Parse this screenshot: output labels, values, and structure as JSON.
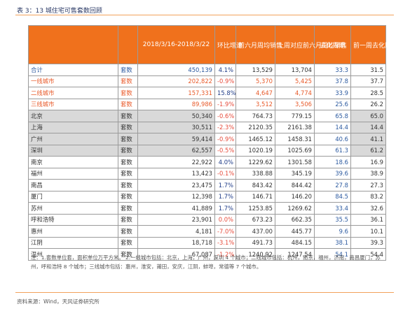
{
  "caption": "表 3：13 城住宅可售套数回顾",
  "header": {
    "col1": "",
    "col2": "",
    "col3": "2018/3/16-2018/3/22",
    "col4": "环比增速",
    "col5": "前六月周均销售",
    "col6": "上周对应前六月周均销售",
    "col7": "去化周期",
    "col8": "前一周去化周期"
  },
  "rows": [
    {
      "name": "合计",
      "unit": "套数",
      "value": "450,139",
      "chg": "4.1%",
      "avg6": "13,529",
      "prev6": "13,704",
      "cycle": "33.3",
      "prevcycle": "31.5",
      "style": "blue",
      "neg": false
    },
    {
      "name": "一线城市",
      "unit": "套数",
      "value": "202,822",
      "chg": "-0.9%",
      "avg6": "5,370",
      "prev6": "5,425",
      "cycle": "37.8",
      "prevcycle": "37.7",
      "style": "orange",
      "neg": true
    },
    {
      "name": "二线城市",
      "unit": "套数",
      "value": "157,331",
      "chg": "15.8%",
      "avg6": "4,647",
      "prev6": "4,774",
      "cycle": "33.9",
      "prevcycle": "28.5",
      "style": "orange",
      "neg": false
    },
    {
      "name": "三线城市",
      "unit": "套数",
      "value": "89,986",
      "chg": "-1.9%",
      "avg6": "3,512",
      "prev6": "3,506",
      "cycle": "25.6",
      "prevcycle": "26.2",
      "style": "orange",
      "neg": true
    },
    {
      "name": "北京",
      "unit": "套数",
      "value": "50,340",
      "chg": "-0.6%",
      "avg6": "764.73",
      "prev6": "779.15",
      "cycle": "65.8",
      "prevcycle": "65.0",
      "style": "gray",
      "neg": true
    },
    {
      "name": "上海",
      "unit": "套数",
      "value": "30,511",
      "chg": "-2.3%",
      "avg6": "2120.35",
      "prev6": "2161.38",
      "cycle": "14.4",
      "prevcycle": "14.4",
      "style": "gray",
      "neg": true
    },
    {
      "name": "广州",
      "unit": "套数",
      "value": "59,414",
      "chg": "-0.9%",
      "avg6": "1465.12",
      "prev6": "1458.31",
      "cycle": "40.6",
      "prevcycle": "41.1",
      "style": "gray",
      "neg": true
    },
    {
      "name": "深圳",
      "unit": "套数",
      "value": "62,557",
      "chg": "-0.5%",
      "avg6": "1020.19",
      "prev6": "1025.69",
      "cycle": "61.3",
      "prevcycle": "61.2",
      "style": "gray",
      "neg": true
    },
    {
      "name": "南京",
      "unit": "套数",
      "value": "22,922",
      "chg": "4.0%",
      "avg6": "1229.62",
      "prev6": "1301.58",
      "cycle": "18.6",
      "prevcycle": "16.9",
      "style": "plain",
      "neg": false
    },
    {
      "name": "福州",
      "unit": "套数",
      "value": "13,423",
      "chg": "-0.1%",
      "avg6": "338.88",
      "prev6": "345.19",
      "cycle": "39.6",
      "prevcycle": "38.9",
      "style": "plain",
      "neg": true
    },
    {
      "name": "南昌",
      "unit": "套数",
      "value": "23,475",
      "chg": "1.7%",
      "avg6": "843.42",
      "prev6": "844.42",
      "cycle": "27.8",
      "prevcycle": "27.3",
      "style": "plain",
      "neg": false
    },
    {
      "name": "厦门",
      "unit": "套数",
      "value": "12,398",
      "chg": "1.7%",
      "avg6": "146.71",
      "prev6": "146.20",
      "cycle": "84.5",
      "prevcycle": "83.2",
      "style": "plain",
      "neg": false
    },
    {
      "name": "苏州",
      "unit": "套数",
      "value": "41,889",
      "chg": "1.7%",
      "avg6": "1253.85",
      "prev6": "1269.62",
      "cycle": "33.4",
      "prevcycle": "32.6",
      "style": "plain",
      "neg": false
    },
    {
      "name": "呼和浩特",
      "unit": "套数",
      "value": "23,901",
      "chg": "0.0%",
      "avg6": "673.23",
      "prev6": "662.35",
      "cycle": "35.5",
      "prevcycle": "36.1",
      "style": "plain",
      "neg": true
    },
    {
      "name": "惠州",
      "unit": "套数",
      "value": "4,181",
      "chg": "-7.0%",
      "avg6": "437.00",
      "prev6": "445.77",
      "cycle": "9.6",
      "prevcycle": "10.1",
      "style": "plain",
      "neg": true
    },
    {
      "name": "江阴",
      "unit": "套数",
      "value": "18,718",
      "chg": "-3.1%",
      "avg6": "491.73",
      "prev6": "484.15",
      "cycle": "38.1",
      "prevcycle": "39.3",
      "style": "plain",
      "neg": true
    },
    {
      "name": "温州",
      "unit": "套数",
      "value": "67,087",
      "chg": "-1.2%",
      "avg6": "1240.92",
      "prev6": "1247.54",
      "cycle": "54.1",
      "prevcycle": "54.4",
      "style": "plain",
      "neg": true
    }
  ],
  "footnote": "注：1.套数单位套，面积单位万平方米。 2.一线城市包括：北京，上海，广州，深圳 4 个城市；二线城市包括：杭州，南京，福州，济南，南昌厦门，苏州，呼和浩特 8 个城市；三线城市包括：惠州，淮安，莆田，安庆，江阴，蚌埠，常德等 7 个城市。",
  "source": "资料来源：Wind，天风证券研究所",
  "colors": {
    "header_bg": "#f0711c",
    "neg": "#e74c3c",
    "pos": "#1f3c88",
    "tier": "#e85a2a",
    "total": "#2c5aa0",
    "gray": "#d9d9d9"
  }
}
